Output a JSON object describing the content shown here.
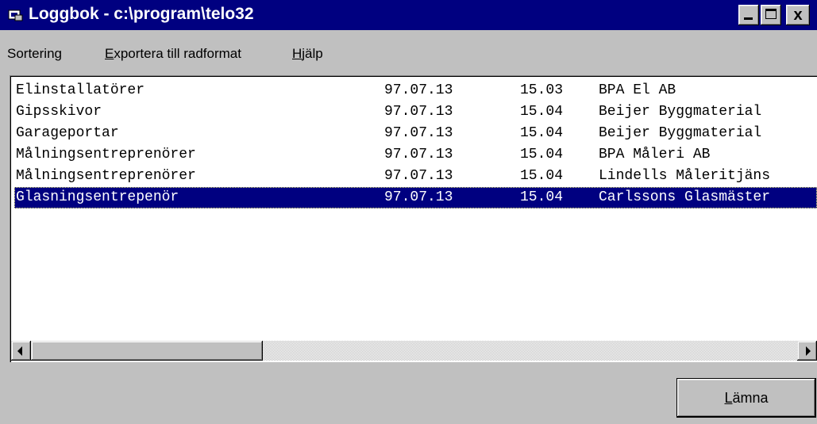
{
  "window": {
    "title": "Loggbok - c:\\program\\telo32",
    "icon": "app-icon",
    "controls": {
      "minimize": "minimize-icon",
      "maximize": "maximize-icon",
      "close": "close-icon",
      "close_glyph": "x"
    }
  },
  "menu": {
    "items": [
      {
        "prefix": "",
        "accel": "",
        "label": "Sortering"
      },
      {
        "prefix": "",
        "accel": "E",
        "label": "xportera till radformat"
      },
      {
        "prefix": "",
        "accel": "H",
        "label": "jälp"
      }
    ]
  },
  "list": {
    "rows": [
      {
        "name": "Elinstallatörer",
        "date": "97.07.13",
        "time": "15.03",
        "company": "BPA El AB"
      },
      {
        "name": "Gipsskivor",
        "date": "97.07.13",
        "time": "15.04",
        "company": "Beijer Byggmaterial"
      },
      {
        "name": "Garageportar",
        "date": "97.07.13",
        "time": "15.04",
        "company": "Beijer Byggmaterial"
      },
      {
        "name": "Målningsentreprenörer",
        "date": "97.07.13",
        "time": "15.04",
        "company": "BPA Måleri AB"
      },
      {
        "name": "Målningsentreprenörer",
        "date": "97.07.13",
        "time": "15.04",
        "company": "Lindells Måleritjäns"
      },
      {
        "name": "Glasningsentrepenör",
        "date": "97.07.13",
        "time": "15.04",
        "company": "Carlssons Glasmäster"
      }
    ],
    "selected_index": 5
  },
  "colors": {
    "titlebar": "#000080",
    "face": "#c0c0c0",
    "selection": "#000080"
  },
  "leave_button": {
    "accel": "L",
    "label": "ämna"
  }
}
